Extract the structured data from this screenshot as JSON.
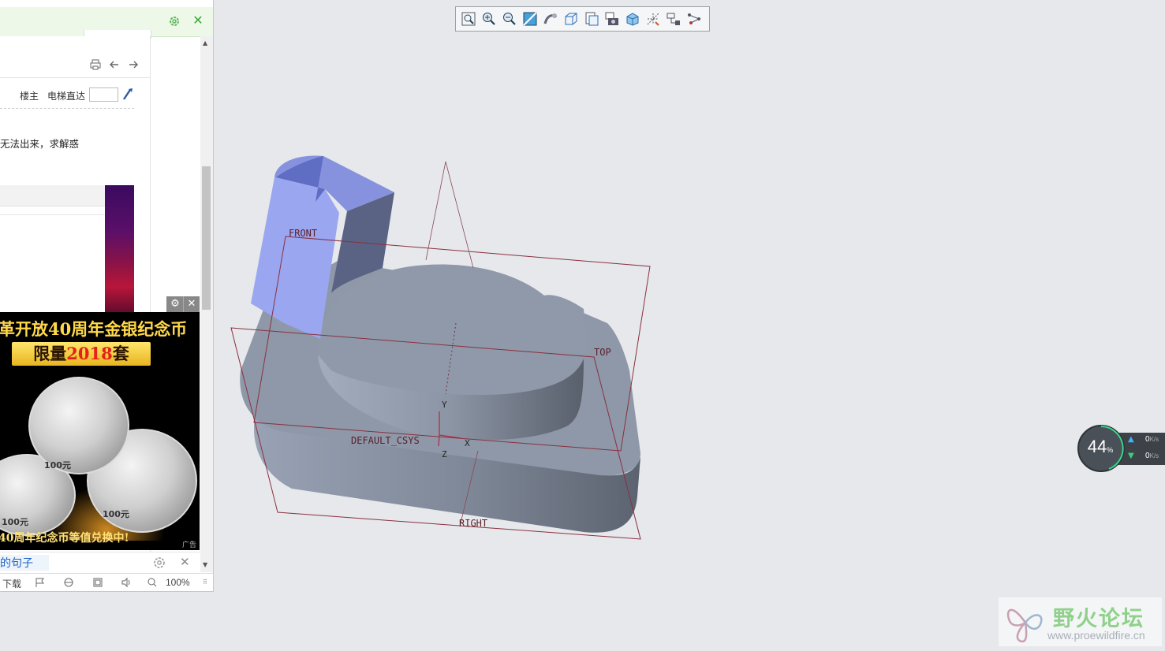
{
  "browser": {
    "post_toolbar": {
      "print": "print-icon",
      "prev": "prev-page-icon",
      "next": "next-page-icon"
    },
    "floor_owner_label": "楼主",
    "elevator_label": "电梯直达",
    "post_text": "无法出来，求解惑",
    "ad": {
      "headline": "革开放40周年金银纪念币",
      "limited_prefix": "限量",
      "limited_number": "2018",
      "limited_suffix": "套",
      "coin_value": "100元",
      "footer": "40周年纪念币等值兑换中!",
      "tag": "广告"
    },
    "search_link": "的句子",
    "status": {
      "download": "下载",
      "zoom": "100%"
    }
  },
  "cad": {
    "toolbar": [
      "refit-icon",
      "zoom-in-icon",
      "zoom-out-icon",
      "repaint-icon",
      "display-style-icon",
      "saved-views-icon",
      "view-manager-icon",
      "camera-icon",
      "perspective-icon",
      "datum-display-icon",
      "spin-center-icon",
      "annotation-display-icon"
    ],
    "datum_labels": {
      "front": "FRONT",
      "top": "TOP",
      "right": "RIGHT",
      "csys": "DEFAULT_CSYS",
      "x": "X",
      "y": "Y",
      "z": "Z"
    }
  },
  "net_monitor": {
    "percent": "44",
    "percent_unit": "%",
    "upload": "0",
    "download": "0",
    "unit": "K/s"
  },
  "watermark": {
    "name": "野火论坛",
    "url": "www.proewildfire.cn"
  },
  "colors": {
    "model_gray": "#8e98a8",
    "highlight_blue": "#9aa6ef",
    "datum_plane": "#8a3040",
    "background": "#e6e8eb"
  }
}
